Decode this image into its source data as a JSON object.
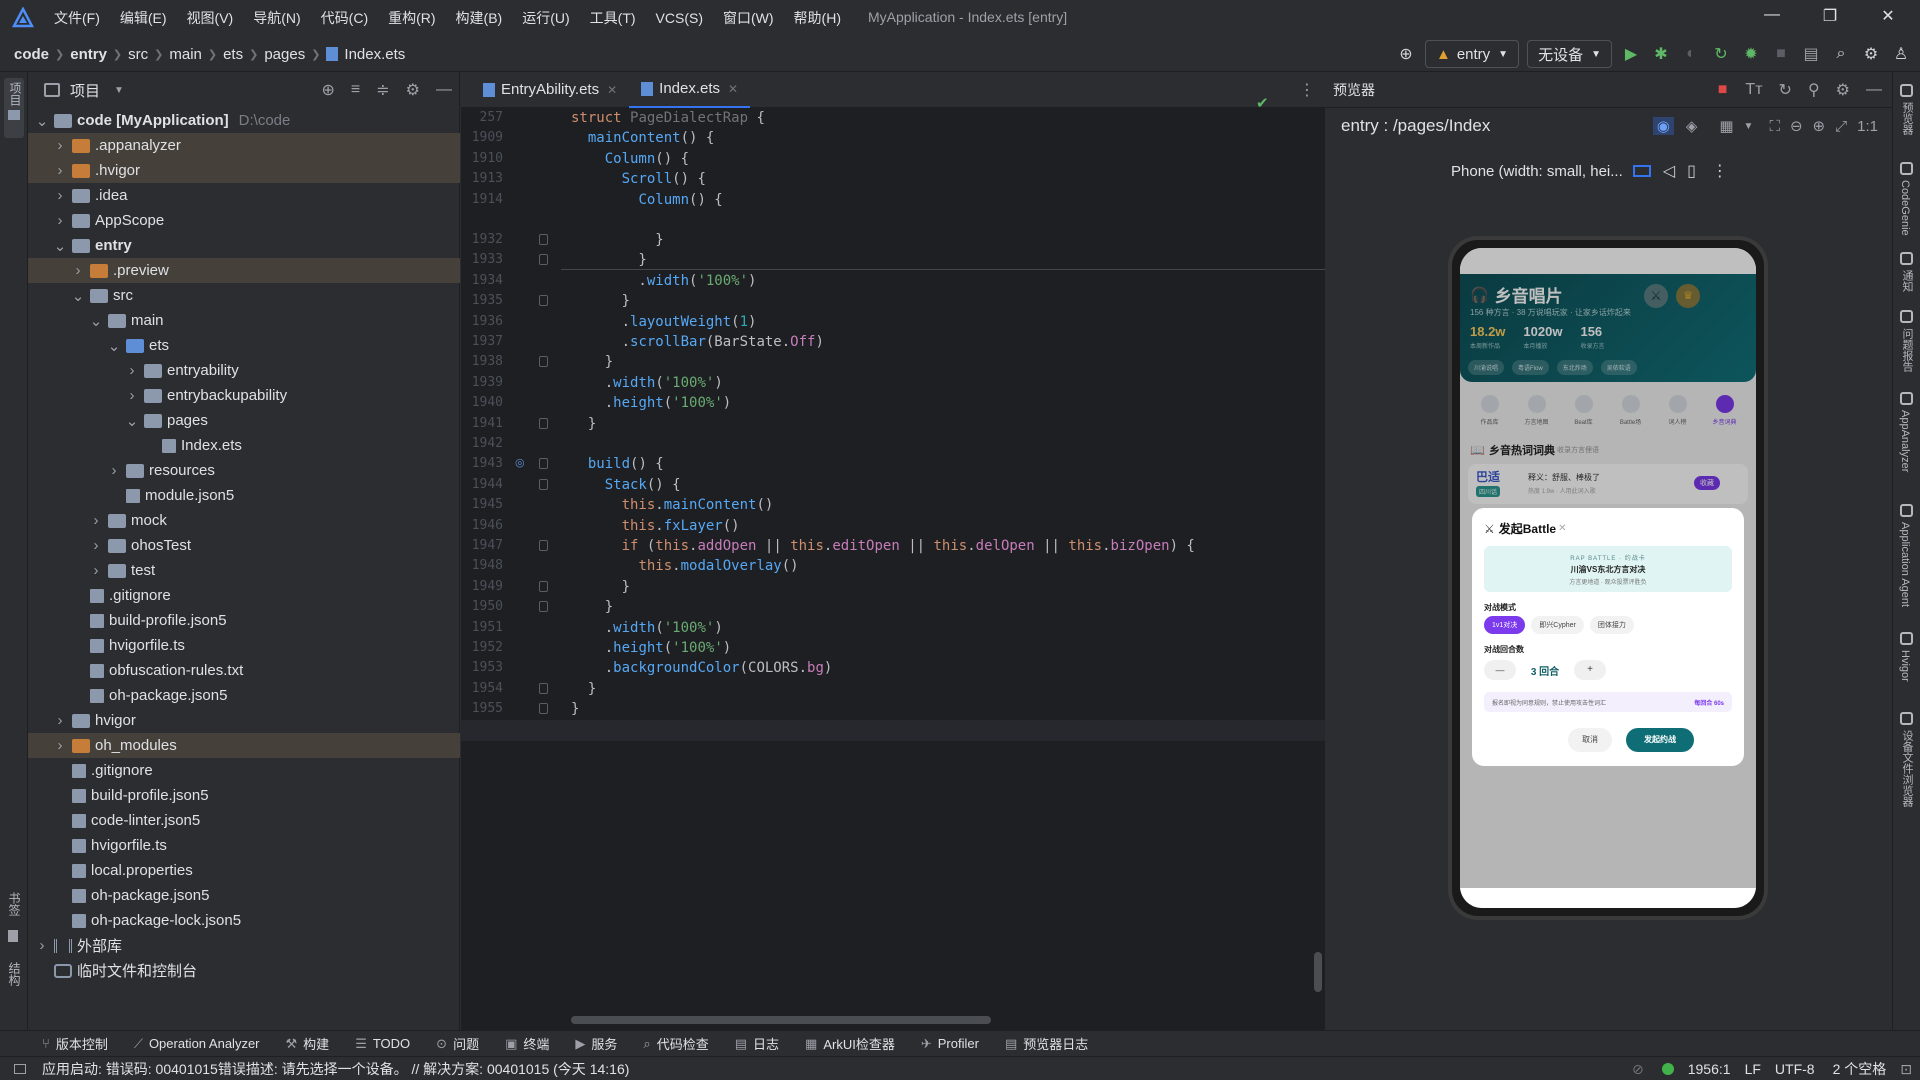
{
  "titlebar": {
    "menus": [
      "文件(F)",
      "编辑(E)",
      "视图(V)",
      "导航(N)",
      "代码(C)",
      "重构(R)",
      "构建(B)",
      "运行(U)",
      "工具(T)",
      "VCS(S)",
      "窗口(W)",
      "帮助(H)"
    ],
    "window_title": "MyApplication - Index.ets [entry]"
  },
  "breadcrumb": [
    "code",
    "entry",
    "src",
    "main",
    "ets",
    "pages",
    "Index.ets"
  ],
  "toolbar": {
    "module_combo": "entry",
    "device_combo": "无设备"
  },
  "left_strip": {
    "top_label": "项目",
    "bottom_label1": "书签",
    "bottom_label2": "结构"
  },
  "project": {
    "header": "项目",
    "tree": [
      {
        "label": "code [MyApplication]",
        "extra": "D:\\code",
        "depth": 0,
        "arrow": "v",
        "icon": "folder",
        "bold": true
      },
      {
        "label": ".appanalyzer",
        "depth": 1,
        "arrow": ">",
        "icon": "folder-orange",
        "hl": true
      },
      {
        "label": ".hvigor",
        "depth": 1,
        "arrow": ">",
        "icon": "folder-orange",
        "hl": true
      },
      {
        "label": ".idea",
        "depth": 1,
        "arrow": ">",
        "icon": "folder"
      },
      {
        "label": "AppScope",
        "depth": 1,
        "arrow": ">",
        "icon": "folder"
      },
      {
        "label": "entry",
        "depth": 1,
        "arrow": "v",
        "icon": "folder",
        "bold": true
      },
      {
        "label": ".preview",
        "depth": 2,
        "arrow": ">",
        "icon": "folder-orange",
        "hl": true
      },
      {
        "label": "src",
        "depth": 2,
        "arrow": "v",
        "icon": "folder"
      },
      {
        "label": "main",
        "depth": 3,
        "arrow": "v",
        "icon": "folder"
      },
      {
        "label": "ets",
        "depth": 4,
        "arrow": "v",
        "icon": "folder-blue"
      },
      {
        "label": "entryability",
        "depth": 5,
        "arrow": ">",
        "icon": "folder"
      },
      {
        "label": "entrybackupability",
        "depth": 5,
        "arrow": ">",
        "icon": "folder"
      },
      {
        "label": "pages",
        "depth": 5,
        "arrow": "v",
        "icon": "folder"
      },
      {
        "label": "Index.ets",
        "depth": 6,
        "arrow": "",
        "icon": "file"
      },
      {
        "label": "resources",
        "depth": 4,
        "arrow": ">",
        "icon": "folder"
      },
      {
        "label": "module.json5",
        "depth": 4,
        "arrow": "",
        "icon": "file"
      },
      {
        "label": "mock",
        "depth": 3,
        "arrow": ">",
        "icon": "folder"
      },
      {
        "label": "ohosTest",
        "depth": 3,
        "arrow": ">",
        "icon": "folder"
      },
      {
        "label": "test",
        "depth": 3,
        "arrow": ">",
        "icon": "folder"
      },
      {
        "label": ".gitignore",
        "depth": 2,
        "arrow": "",
        "icon": "file"
      },
      {
        "label": "build-profile.json5",
        "depth": 2,
        "arrow": "",
        "icon": "file"
      },
      {
        "label": "hvigorfile.ts",
        "depth": 2,
        "arrow": "",
        "icon": "file"
      },
      {
        "label": "obfuscation-rules.txt",
        "depth": 2,
        "arrow": "",
        "icon": "file"
      },
      {
        "label": "oh-package.json5",
        "depth": 2,
        "arrow": "",
        "icon": "file"
      },
      {
        "label": "hvigor",
        "depth": 1,
        "arrow": ">",
        "icon": "folder"
      },
      {
        "label": "oh_modules",
        "depth": 1,
        "arrow": ">",
        "icon": "folder-orange",
        "hl": true
      },
      {
        "label": ".gitignore",
        "depth": 1,
        "arrow": "",
        "icon": "file"
      },
      {
        "label": "build-profile.json5",
        "depth": 1,
        "arrow": "",
        "icon": "file"
      },
      {
        "label": "code-linter.json5",
        "depth": 1,
        "arrow": "",
        "icon": "file"
      },
      {
        "label": "hvigorfile.ts",
        "depth": 1,
        "arrow": "",
        "icon": "file"
      },
      {
        "label": "local.properties",
        "depth": 1,
        "arrow": "",
        "icon": "file"
      },
      {
        "label": "oh-package.json5",
        "depth": 1,
        "arrow": "",
        "icon": "file"
      },
      {
        "label": "oh-package-lock.json5",
        "depth": 1,
        "arrow": "",
        "icon": "file"
      },
      {
        "label": "外部库",
        "depth": 0,
        "arrow": ">",
        "icon": "lib"
      },
      {
        "label": "临时文件和控制台",
        "depth": 0,
        "arrow": "",
        "icon": "scratch"
      }
    ]
  },
  "editor": {
    "tabs": [
      {
        "label": "EntryAbility.ets",
        "active": false
      },
      {
        "label": "Index.ets",
        "active": true
      }
    ],
    "sticky": [
      {
        "ln": "257",
        "html": "<span class=\"kw\">struct</span> <span class=\"cls\" style=\"color:#6f737a\">PageDialectRap</span> {"
      },
      {
        "ln": "1909",
        "html": "  <span class=\"fn\">mainContent</span>() {"
      },
      {
        "ln": "1910",
        "html": "    <span class=\"fn\">Column</span>() {"
      },
      {
        "ln": "1913",
        "html": "      <span class=\"fn\">Scroll</span>() {"
      },
      {
        "ln": "1914",
        "html": "        <span class=\"fn\">Column</span>() {"
      }
    ],
    "lines": [
      {
        "ln": "1932",
        "text": "          }"
      },
      {
        "ln": "1933",
        "text": "        }"
      },
      {
        "ln": "1934",
        "text": "        .width('100%')"
      },
      {
        "ln": "1935",
        "text": "      }"
      },
      {
        "ln": "1936",
        "text": "      .layoutWeight(1)"
      },
      {
        "ln": "1937",
        "text": "      .scrollBar(BarState.Off)"
      },
      {
        "ln": "1938",
        "text": "    }"
      },
      {
        "ln": "1939",
        "text": "    .width('100%')"
      },
      {
        "ln": "1940",
        "text": "    .height('100%')"
      },
      {
        "ln": "1941",
        "text": "  }"
      },
      {
        "ln": "1942",
        "text": ""
      },
      {
        "ln": "1943",
        "text": "  build() {"
      },
      {
        "ln": "1944",
        "text": "    Stack() {"
      },
      {
        "ln": "1945",
        "text": "      this.mainContent()"
      },
      {
        "ln": "1946",
        "text": "      this.fxLayer()"
      },
      {
        "ln": "1947",
        "text": "      if (this.addOpen || this.editOpen || this.delOpen || this.bizOpen) {"
      },
      {
        "ln": "1948",
        "text": "        this.modalOverlay()"
      },
      {
        "ln": "1949",
        "text": "      }"
      },
      {
        "ln": "1950",
        "text": "    }"
      },
      {
        "ln": "1951",
        "text": "    .width('100%')"
      },
      {
        "ln": "1952",
        "text": "    .height('100%')"
      },
      {
        "ln": "1953",
        "text": "    .backgroundColor(COLORS.bg)"
      },
      {
        "ln": "1954",
        "text": "  }"
      },
      {
        "ln": "1955",
        "text": "}"
      },
      {
        "ln": "1956",
        "text": ""
      }
    ]
  },
  "preview": {
    "panel_title": "预览器",
    "route": "entry : /pages/Index",
    "device_label": "Phone (width: small, hei...",
    "app": {
      "title": "乡音唱片",
      "subtitle": "156 种方言 · 38 万说唱玩家 · 让家乡话炸起来",
      "stats": [
        {
          "value": "18.2w",
          "label": "本周新作品"
        },
        {
          "value": "1020w",
          "label": "本月播放"
        },
        {
          "value": "156",
          "label": "收录方言"
        }
      ],
      "chips": [
        "川渝说唱",
        "粤语Flow",
        "东北炸场",
        "吴侬软语"
      ],
      "categories": [
        "作品库",
        "方言地图",
        "Beat库",
        "Battle场",
        "词人榜",
        "乡音词典"
      ],
      "dict_title": "乡音热词词典",
      "dict_sub": "收录方言俚语",
      "word": "巴适",
      "word_tag": "四川话",
      "word_meaning": "释义：舒服、棒极了",
      "word_heat": "热度 1.9w · 人用此词入歌",
      "word_btn": "收藏"
    },
    "modal": {
      "title": "发起Battle",
      "banner_small": "RAP BATTLE · 约战卡",
      "banner_main": "川渝VS东北方言对决",
      "banner_sub": "方言更地道 · 观众投票评胜负",
      "mode_label": "对战模式",
      "modes": [
        "1v1对决",
        "即兴Cypher",
        "团体接力"
      ],
      "rounds_label": "对战回合数",
      "minus": "—",
      "rounds_value": "3 回合",
      "plus": "+",
      "notice": "报名即视为同意规则，禁止使用攻击性词汇",
      "notice_right": "每回合 60s",
      "cancel": "取消",
      "confirm": "发起约战"
    }
  },
  "right_strip": [
    "预览器",
    "CodeGenie",
    "通知",
    "问题报告",
    "AppAnalyzer",
    "Application Agent",
    "Hvigor",
    "设备文件浏览器"
  ],
  "bottom_tools": [
    {
      "icon": "⑂",
      "label": "版本控制"
    },
    {
      "icon": "⟋",
      "label": "Operation Analyzer"
    },
    {
      "icon": "⚒",
      "label": "构建"
    },
    {
      "icon": "☰",
      "label": "TODO"
    },
    {
      "icon": "⊙",
      "label": "问题"
    },
    {
      "icon": "▣",
      "label": "终端"
    },
    {
      "icon": "▶",
      "label": "服务"
    },
    {
      "icon": "⌕",
      "label": "代码检查"
    },
    {
      "icon": "▤",
      "label": "日志"
    },
    {
      "icon": "▦",
      "label": "ArkUI检查器"
    },
    {
      "icon": "✈",
      "label": "Profiler"
    },
    {
      "icon": "▤",
      "label": "预览器日志"
    }
  ],
  "status": {
    "message": "应用启动: 错误码: 00401015错误描述: 请先选择一个设备。 // 解决方案: 00401015 (今天 14:16)",
    "position": "1956:1",
    "line_sep": "LF",
    "encoding": "UTF-8",
    "indent": "2 个空格"
  }
}
